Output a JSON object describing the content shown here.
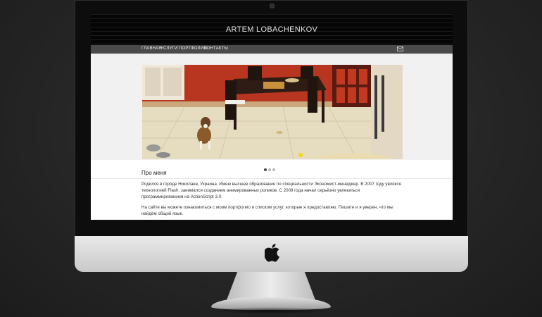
{
  "site": {
    "title": "ARTEM LOBACHENKOV",
    "nav": [
      {
        "label": "ГЛАВНАЯ"
      },
      {
        "label": "УСЛУГИ"
      },
      {
        "label": "ПОРТФОЛИО"
      },
      {
        "label": "КОНТАКТЫ"
      }
    ],
    "nav_icon": "mail-icon",
    "slider": {
      "slide_count": 3,
      "active_index": 0
    },
    "about": {
      "heading": "Про меня",
      "paragraph1": "Родился в городе Николаев, Украина. Имею высшее образование по специальности Экономист-менеджер. В 2007 году увлёкся технологией Flash, занимался созданием анимированных роликов. С 2009 года начал серьёзно увлекаться программированием на ActionScript 3.0.",
      "paragraph2": "На сайте вы можете ознакомиться с моим портфолио и списком услуг, которые я предоставляю. Пишите и я уверен, что мы найдём общий язык."
    }
  },
  "device": {
    "logo": "apple-logo-icon"
  },
  "colors": {
    "header_bg": "#050505",
    "nav_bg": "#4a4a4a",
    "kitchen_wall": "#b8351f",
    "floor": "#e6dcc0"
  }
}
